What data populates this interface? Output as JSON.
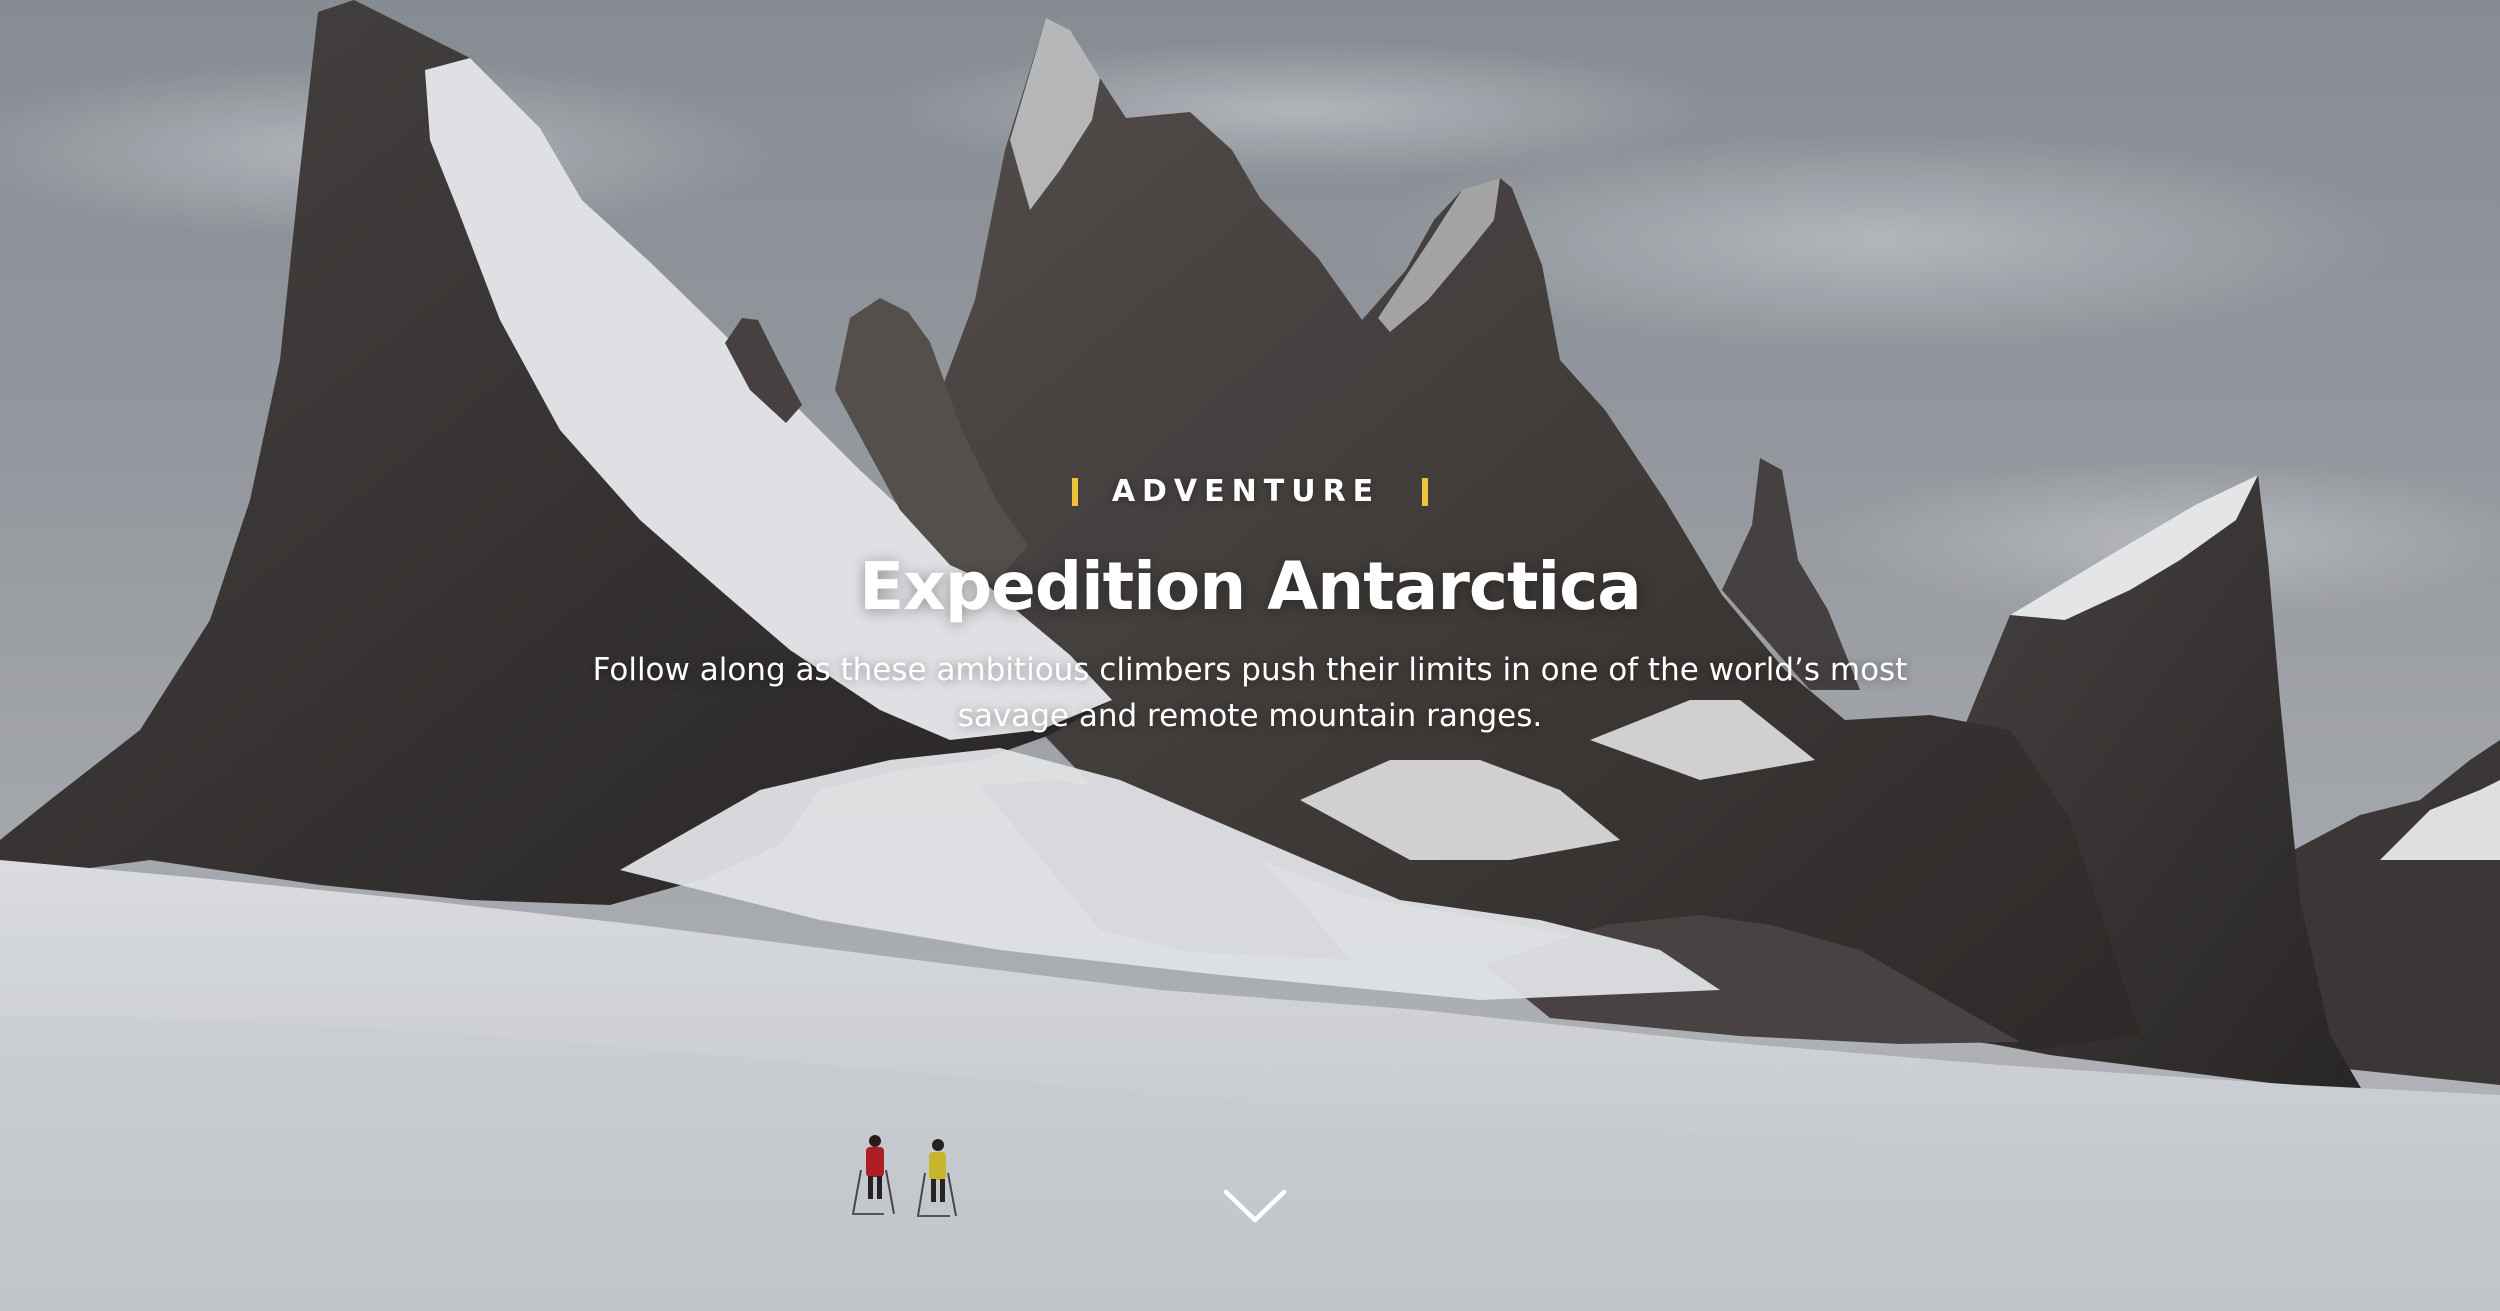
{
  "hero": {
    "kicker": "ADVENTURE",
    "title": "Expedition Antarctica",
    "dek": "Follow along as these ambitious climbers push their limits in one of the world’s most savage and remote mountain ranges.",
    "scroll_icon": "chevron-down-icon"
  },
  "colors": {
    "accent": "#f0c43a",
    "text": "#ffffff"
  }
}
